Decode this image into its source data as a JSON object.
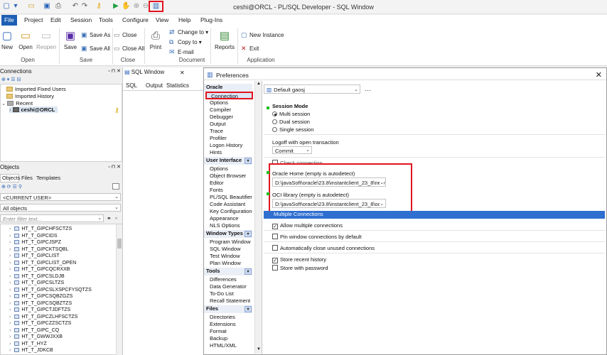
{
  "window": {
    "title": "ceshi@ORCL - PL/SQL Developer - SQL Window"
  },
  "menu": [
    {
      "label": "File"
    },
    {
      "label": "Project"
    },
    {
      "label": "Edit"
    },
    {
      "label": "Session"
    },
    {
      "label": "Tools"
    },
    {
      "label": "Configure"
    },
    {
      "label": "View"
    },
    {
      "label": "Help"
    },
    {
      "label": "Plug-Ins"
    }
  ],
  "ribbon": {
    "new": "New",
    "open": "Open",
    "reopen": "Reopen",
    "save": "Save",
    "save_as": "Save As",
    "save_all": "Save All",
    "close": "Close",
    "close_all": "Close All",
    "print": "Print",
    "change_to": "Change to",
    "copy_to": "Copy to",
    "email": "E-mail",
    "reports": "Reports",
    "new_instance": "New Instance",
    "exit": "Exit",
    "groups": {
      "open": "Open",
      "save": "Save",
      "close": "Close",
      "document": "Document",
      "application": "Application"
    }
  },
  "connections": {
    "title": "Connections",
    "items": [
      "Imported Fixed Users",
      "Imported History",
      "Recent",
      "ceshi@ORCL"
    ]
  },
  "objects": {
    "title": "Objects",
    "tabs": [
      "Objects",
      "Files",
      "Templates"
    ],
    "user": "<CURRENT USER>",
    "filter_mode": "All objects",
    "filter_placeholder": "Enter filter text...",
    "rows": [
      "HT_T_GIPCHFSCTZS",
      "HT_T_GIPCIDS",
      "HT_T_GIPCJSPZ",
      "HT_T_GIPCKTSQBL",
      "HT_T_GIPCLIST",
      "HT_T_GIPCLIST_OPEN",
      "HT_T_GIPCQCRXXB",
      "HT_T_GIPCSLDJB",
      "HT_T_GIPCSLTZS",
      "HT_T_GIPCSLXSPCFYSQTZS",
      "HT_T_GIPCSQBZGZS",
      "HT_T_GIPCSQBZTZS",
      "HT_T_GIPCTJDFTZS",
      "HT_T_GIPCZLHFSCTZS",
      "HT_T_GIPCZZSCTZS",
      "HT_T_GIPC_CQ",
      "HT_T_GWWJXXB",
      "HT_T_HYZ",
      "HT_T_JDKCB"
    ]
  },
  "sql_window": {
    "tab": "SQL Window",
    "subtabs": [
      "SQL",
      "Output",
      "Statistics"
    ]
  },
  "preferences": {
    "title": "Preferences",
    "profile": "Default gaosj",
    "categories": [
      {
        "header": "Oracle",
        "items": [
          "Connection",
          "Options",
          "Compiler",
          "Debugger",
          "Output",
          "Trace",
          "Profiler",
          "Logon History",
          "Hints"
        ]
      },
      {
        "header": "User Interface",
        "items": [
          "Options",
          "Object Browser",
          "Editor",
          "Fonts",
          "PL/SQL Beautifier",
          "Code Assistant",
          "Key Configuration",
          "Appearance",
          "NLS Options"
        ]
      },
      {
        "header": "Window Types",
        "items": [
          "Program Window",
          "SQL Window",
          "Test Window",
          "Plan Window"
        ]
      },
      {
        "header": "Tools",
        "items": [
          "Differences",
          "Data Generator",
          "To-Do List",
          "Recall Statement"
        ]
      },
      {
        "header": "Files",
        "items": [
          "Directories",
          "Extensions",
          "Format",
          "Backup",
          "HTML/XML"
        ]
      }
    ],
    "session_mode": {
      "label": "Session Mode",
      "options": [
        "Multi session",
        "Dual session",
        "Single session"
      ],
      "selected": "Multi session"
    },
    "logoff": {
      "label": "Logoff with open transaction",
      "value": "Commit"
    },
    "check_connection": "Check connection",
    "oracle_home": {
      "label": "Oracle Home (empty is autodetect)",
      "value": "D:\\javaSoft\\oracle\\23.8\\instantclient_23_8\\netv"
    },
    "oci_library": {
      "label": "OCI library (empty is autodetect)",
      "value": "D:\\javaSoft\\oracle\\23.8\\instantclient_23_8\\oci."
    },
    "multiple_connections": "Multiple Connections",
    "checkboxes": [
      {
        "label": "Allow multiple connections",
        "checked": true
      },
      {
        "label": "Pin window connections by default",
        "checked": false
      },
      {
        "label": "Automatically close unused connections",
        "checked": false
      },
      {
        "label": "Store recent history",
        "checked": true
      },
      {
        "label": "Store with password",
        "checked": false
      }
    ]
  },
  "colors": {
    "accent": "#1e5fb4",
    "highlight_red": "#e0141e",
    "section_blue": "#2f6fd0"
  }
}
